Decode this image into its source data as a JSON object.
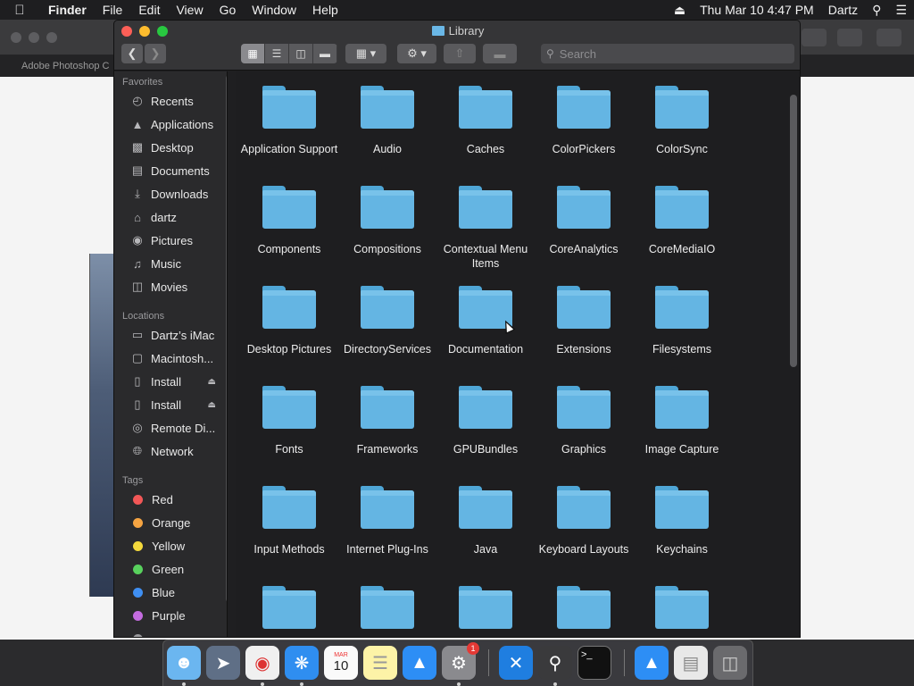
{
  "menubar": {
    "app": "Finder",
    "menus": [
      "File",
      "Edit",
      "View",
      "Go",
      "Window",
      "Help"
    ],
    "datetime": "Thu Mar 10  4:47 PM",
    "user": "Dartz"
  },
  "background_app": {
    "tab_label": "Adobe Photoshop C"
  },
  "window": {
    "title": "Library",
    "search_placeholder": "Search"
  },
  "sidebar": {
    "favorites_header": "Favorites",
    "favorites": [
      {
        "label": "Recents",
        "icon": "clock-icon"
      },
      {
        "label": "Applications",
        "icon": "applications-icon"
      },
      {
        "label": "Desktop",
        "icon": "desktop-icon"
      },
      {
        "label": "Documents",
        "icon": "document-icon"
      },
      {
        "label": "Downloads",
        "icon": "download-icon"
      },
      {
        "label": "dartz",
        "icon": "home-icon"
      },
      {
        "label": "Pictures",
        "icon": "camera-icon"
      },
      {
        "label": "Music",
        "icon": "music-icon"
      },
      {
        "label": "Movies",
        "icon": "film-icon"
      }
    ],
    "locations_header": "Locations",
    "locations": [
      {
        "label": "Dartz’s iMac",
        "icon": "imac-icon"
      },
      {
        "label": "Macintosh...",
        "icon": "hard-drive-icon"
      },
      {
        "label": "Install",
        "icon": "disk-icon"
      },
      {
        "label": "Install",
        "icon": "disk-icon"
      },
      {
        "label": "Remote Di...",
        "icon": "remote-disc-icon"
      },
      {
        "label": "Network",
        "icon": "network-icon"
      }
    ],
    "tags_header": "Tags",
    "tags": [
      {
        "label": "Red",
        "color": "#f25757"
      },
      {
        "label": "Orange",
        "color": "#f5a442"
      },
      {
        "label": "Yellow",
        "color": "#f4d93c"
      },
      {
        "label": "Green",
        "color": "#58d15d"
      },
      {
        "label": "Blue",
        "color": "#3f8ff2"
      },
      {
        "label": "Purple",
        "color": "#c46ce0"
      }
    ]
  },
  "folders": [
    [
      "Application Support",
      "Audio",
      "Caches",
      "ColorPickers",
      "ColorSync"
    ],
    [
      "Components",
      "Compositions",
      "Contextual Menu Items",
      "CoreAnalytics",
      "CoreMediaIO"
    ],
    [
      "Desktop Pictures",
      "DirectoryServices",
      "Documentation",
      "Extensions",
      "Filesystems"
    ],
    [
      "Fonts",
      "Frameworks",
      "GPUBundles",
      "Graphics",
      "Image Capture"
    ],
    [
      "Input Methods",
      "Internet Plug-Ins",
      "Java",
      "Keyboard Layouts",
      "Keychains"
    ],
    [
      "",
      "",
      "",
      "",
      ""
    ]
  ],
  "dock": {
    "calendar_month": "MAR",
    "calendar_day": "10",
    "prefs_badge": "1",
    "apps": [
      "finder-icon",
      "launchpad-icon",
      "chrome-icon",
      "safari-icon",
      "calendar-icon",
      "notes-icon",
      "app-store-icon",
      "system-preferences-icon",
      "xcode-icon",
      "instruments-icon",
      "terminal-icon",
      "app-store-icon",
      "file-icon",
      "trash-icon"
    ]
  },
  "colors": {
    "folder": "#64b5e3",
    "close": "#fc5f57",
    "minimize": "#fdbc2e",
    "zoom": "#28c840"
  }
}
